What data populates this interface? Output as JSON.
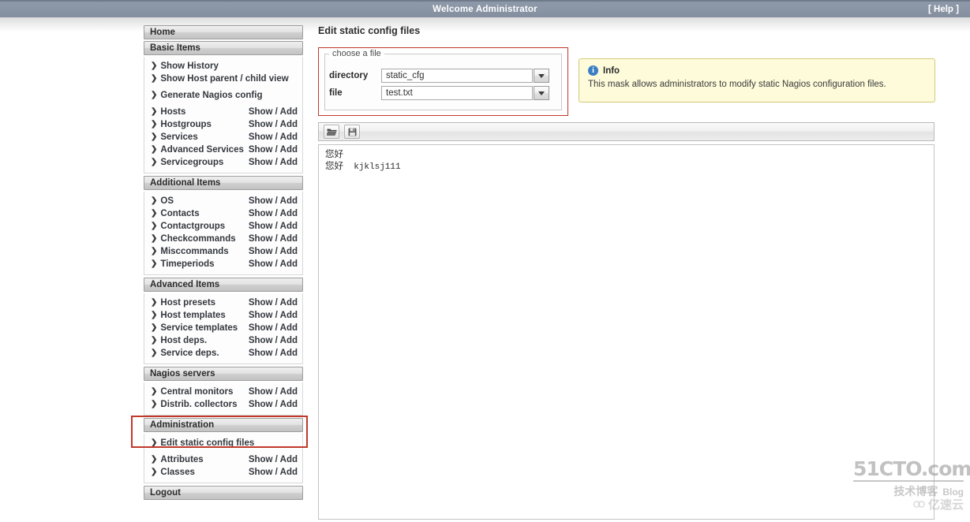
{
  "topbar": {
    "welcome": "Welcome Administrator",
    "help": "[ Help ]"
  },
  "sidebar": {
    "groups": [
      {
        "header": "Home",
        "items": []
      },
      {
        "header": "Basic Items",
        "items": [
          {
            "label": "Show History",
            "action": ""
          },
          {
            "label": "Show Host parent / child view",
            "action": ""
          },
          {
            "label": "Generate Nagios config",
            "action": "",
            "spacer_before": true
          },
          {
            "label": "Hosts",
            "action": "Show / Add",
            "spacer_before": true
          },
          {
            "label": "Hostgroups",
            "action": "Show / Add"
          },
          {
            "label": "Services",
            "action": "Show / Add"
          },
          {
            "label": "Advanced Services",
            "action": "Show / Add"
          },
          {
            "label": "Servicegroups",
            "action": "Show / Add"
          }
        ]
      },
      {
        "header": "Additional Items",
        "items": [
          {
            "label": "OS",
            "action": "Show / Add"
          },
          {
            "label": "Contacts",
            "action": "Show / Add"
          },
          {
            "label": "Contactgroups",
            "action": "Show / Add"
          },
          {
            "label": "Checkcommands",
            "action": "Show / Add"
          },
          {
            "label": "Misccommands",
            "action": "Show / Add"
          },
          {
            "label": "Timeperiods",
            "action": "Show / Add"
          }
        ]
      },
      {
        "header": "Advanced Items",
        "items": [
          {
            "label": "Host presets",
            "action": "Show / Add"
          },
          {
            "label": "Host templates",
            "action": "Show / Add"
          },
          {
            "label": "Service templates",
            "action": "Show / Add"
          },
          {
            "label": "Host deps.",
            "action": "Show / Add"
          },
          {
            "label": "Service deps.",
            "action": "Show / Add"
          }
        ]
      },
      {
        "header": "Nagios servers",
        "items": [
          {
            "label": "Central monitors",
            "action": "Show / Add"
          },
          {
            "label": "Distrib. collectors",
            "action": "Show / Add"
          }
        ]
      },
      {
        "header": "Administration",
        "items": [
          {
            "label": "Edit static config files",
            "action": ""
          },
          {
            "label": "Attributes",
            "action": "Show / Add",
            "spacer_before": true
          },
          {
            "label": "Classes",
            "action": "Show / Add"
          }
        ]
      },
      {
        "header": "Logout",
        "items": []
      }
    ],
    "chevron": "❯"
  },
  "content": {
    "page_title": "Edit static config files",
    "chooser": {
      "legend": "choose a file",
      "directory_label": "directory",
      "directory_value": "static_cfg",
      "file_label": "file",
      "file_value": "test.txt"
    },
    "info": {
      "icon_glyph": "i",
      "title": "Info",
      "text": "This mask allows administrators to modify static Nagios configuration files."
    },
    "editor": {
      "open_button_title": "Open file",
      "save_button_title": "Save file",
      "lines": [
        {
          "cjk": "您好",
          "mono": ""
        },
        {
          "cjk": "您好",
          "mono": "  kjklsj111"
        }
      ]
    }
  },
  "watermark": {
    "main": "51CTO.com",
    "sub_cn": "技术博客",
    "sub_en": "Blog",
    "cloud": "亿速云"
  },
  "colors": {
    "topbar": "#8a95a5",
    "highlight_red": "#c0392b",
    "info_bg": "#fdfbda",
    "info_border": "#d3c87c",
    "info_icon": "#3b7ec4"
  }
}
